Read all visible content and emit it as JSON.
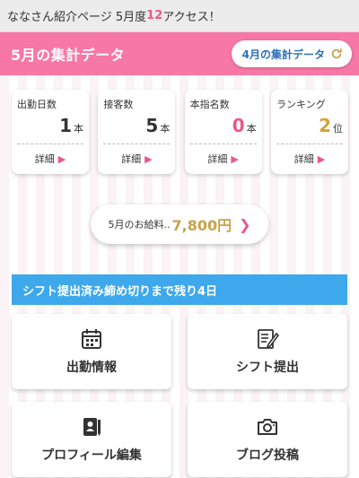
{
  "topbar": {
    "prefix": "ななさん紹介ページ 5月度",
    "count": "12",
    "suffix": "アクセス！"
  },
  "header": {
    "title": "5月の集計データ",
    "button_label": "4月の集計データ"
  },
  "stats": [
    {
      "label": "出勤日数",
      "value": "1",
      "unit": "本",
      "color": "#333333",
      "detail": "詳細"
    },
    {
      "label": "接客数",
      "value": "5",
      "unit": "本",
      "color": "#333333",
      "detail": "詳細"
    },
    {
      "label": "本指名数",
      "value": "0",
      "unit": "本",
      "color": "#e9588a",
      "detail": "詳細"
    },
    {
      "label": "ランキング",
      "value": "2",
      "unit": "位",
      "color": "#d3a43c",
      "detail": "詳細"
    }
  ],
  "salary": {
    "label": "5月のお給料..",
    "amount": "7,800円"
  },
  "notice": "シフト提出済み締め切りまで残り4日",
  "menu": [
    {
      "label": "出勤情報",
      "icon": "calendar-icon"
    },
    {
      "label": "シフト提出",
      "icon": "edit-list-icon"
    },
    {
      "label": "プロフィール編集",
      "icon": "profile-note-icon"
    },
    {
      "label": "ブログ投稿",
      "icon": "camera-icon"
    }
  ]
}
